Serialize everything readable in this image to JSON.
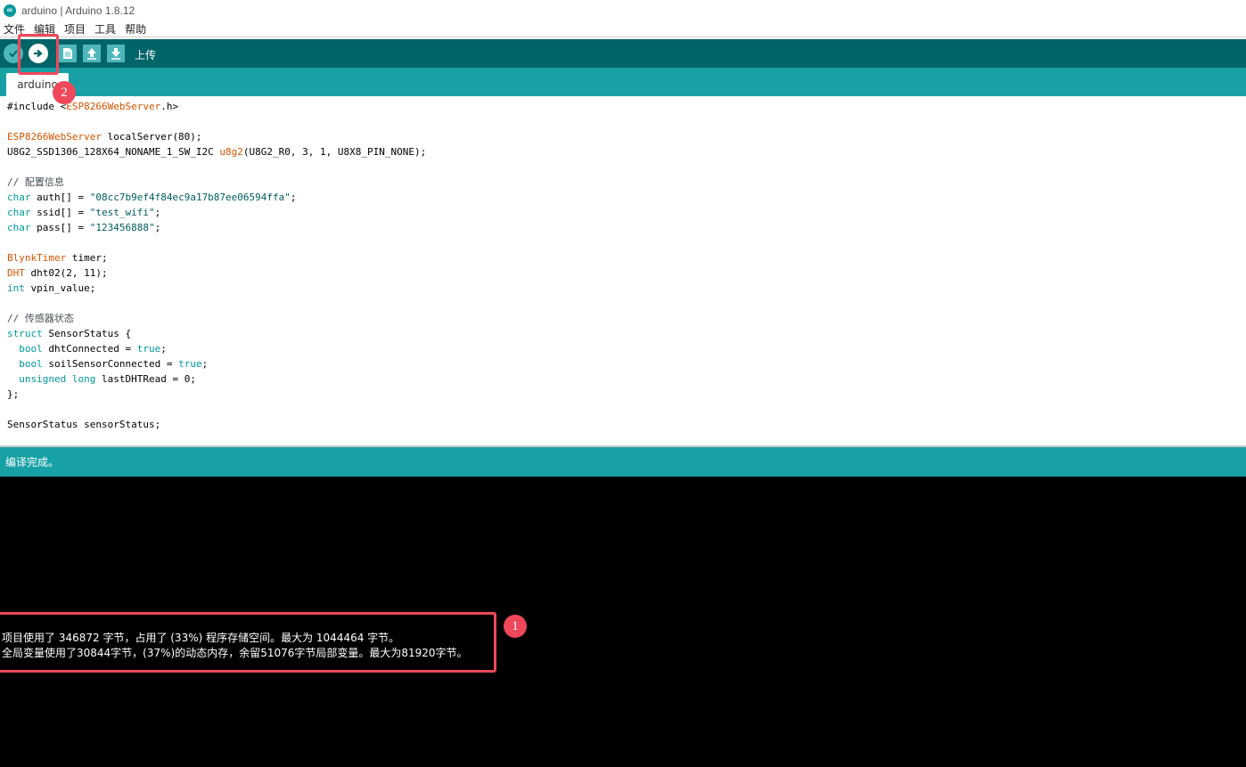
{
  "window": {
    "title": "arduino | Arduino 1.8.12",
    "logo_text": "∞"
  },
  "menu": [
    "文件",
    "编辑",
    "项目",
    "工具",
    "帮助"
  ],
  "toolbar": {
    "hover_label": "上传"
  },
  "tab": {
    "label": "arduino"
  },
  "code": [
    [
      {
        "t": "#include <",
        "c": ""
      },
      {
        "t": "ESP8266WebServer",
        "c": "k-type"
      },
      {
        "t": ".h>",
        "c": ""
      }
    ],
    [],
    [
      {
        "t": "ESP8266WebServer",
        "c": "k-type"
      },
      {
        "t": " localServer(80);",
        "c": ""
      }
    ],
    [
      {
        "t": "U8G2_SSD1306_128X64_NONAME_1_SW_I2C ",
        "c": ""
      },
      {
        "t": "u8g2",
        "c": "k-type"
      },
      {
        "t": "(U8G2_R0, 3, 1, U8X8_PIN_NONE);",
        "c": ""
      }
    ],
    [],
    [
      {
        "t": "// 配置信息",
        "c": "k-cmt"
      }
    ],
    [
      {
        "t": "char",
        "c": "k-kw"
      },
      {
        "t": " auth[] = ",
        "c": ""
      },
      {
        "t": "\"08cc7b9ef4f84ec9a17b87ee06594ffa\"",
        "c": "k-str"
      },
      {
        "t": ";",
        "c": ""
      }
    ],
    [
      {
        "t": "char",
        "c": "k-kw"
      },
      {
        "t": " ssid[] = ",
        "c": ""
      },
      {
        "t": "\"test_wifi\"",
        "c": "k-str"
      },
      {
        "t": ";",
        "c": ""
      }
    ],
    [
      {
        "t": "char",
        "c": "k-kw"
      },
      {
        "t": " pass[] = ",
        "c": ""
      },
      {
        "t": "\"123456888\"",
        "c": "k-str"
      },
      {
        "t": ";",
        "c": ""
      }
    ],
    [],
    [
      {
        "t": "BlynkTimer",
        "c": "k-type"
      },
      {
        "t": " timer;",
        "c": ""
      }
    ],
    [
      {
        "t": "DHT",
        "c": "k-type"
      },
      {
        "t": " dht02(2, 11);",
        "c": ""
      }
    ],
    [
      {
        "t": "int",
        "c": "k-kw"
      },
      {
        "t": " vpin_value;",
        "c": ""
      }
    ],
    [],
    [
      {
        "t": "// 传感器状态",
        "c": "k-cmt"
      }
    ],
    [
      {
        "t": "struct",
        "c": "k-kw"
      },
      {
        "t": " SensorStatus {",
        "c": ""
      }
    ],
    [
      {
        "t": "  ",
        "c": ""
      },
      {
        "t": "bool",
        "c": "k-kw"
      },
      {
        "t": " dhtConnected = ",
        "c": ""
      },
      {
        "t": "true",
        "c": "k-kw"
      },
      {
        "t": ";",
        "c": ""
      }
    ],
    [
      {
        "t": "  ",
        "c": ""
      },
      {
        "t": "bool",
        "c": "k-kw"
      },
      {
        "t": " soilSensorConnected = ",
        "c": ""
      },
      {
        "t": "true",
        "c": "k-kw"
      },
      {
        "t": ";",
        "c": ""
      }
    ],
    [
      {
        "t": "  ",
        "c": ""
      },
      {
        "t": "unsigned",
        "c": "k-kw"
      },
      {
        "t": " ",
        "c": ""
      },
      {
        "t": "long",
        "c": "k-kw"
      },
      {
        "t": " lastDHTRead = 0;",
        "c": ""
      }
    ],
    [
      {
        "t": "};",
        "c": ""
      }
    ],
    [],
    [
      {
        "t": "SensorStatus sensorStatus;",
        "c": ""
      }
    ]
  ],
  "status": {
    "message": "编译完成。"
  },
  "console": {
    "lines": [
      "项目使用了 346872 字节，占用了 (33%) 程序存储空间。最大为 1044464 字节。",
      "全局变量使用了30844字节，(37%)的动态内存，余留51076字节局部变量。最大为81920字节。"
    ]
  },
  "annotations": {
    "badge_1": "1",
    "badge_2": "2",
    "color": "#f0475a"
  },
  "colors": {
    "toolbar": "#006468",
    "tabbar": "#17a1a5",
    "button": "#4db7bb"
  }
}
